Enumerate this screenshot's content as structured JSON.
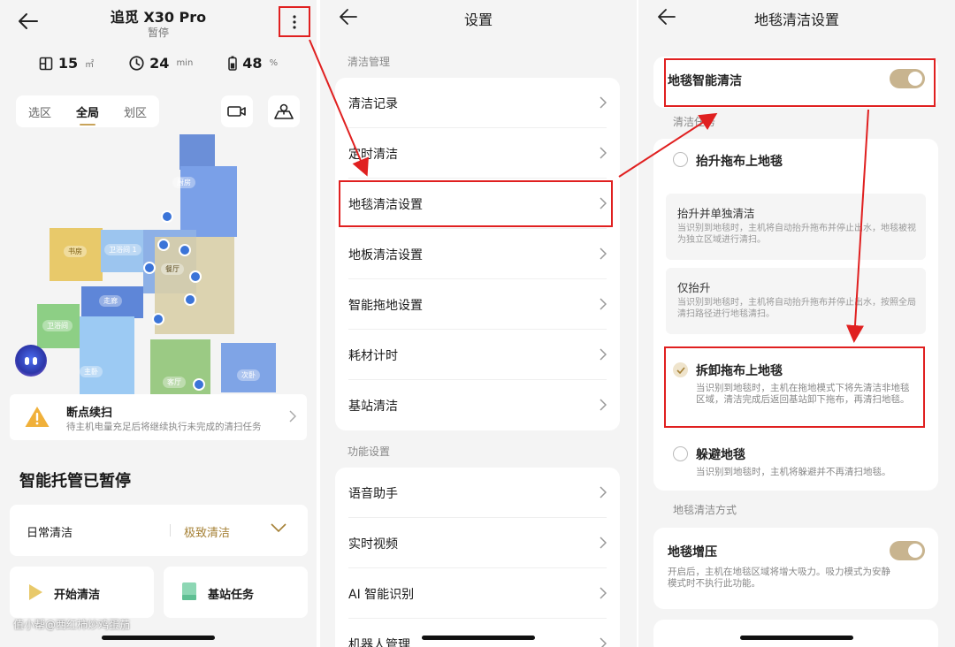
{
  "panel1": {
    "device_name": "追觅 X30 Pro",
    "status": "暂停",
    "stats": [
      {
        "icon": "area-icon",
        "value": "15",
        "unit": "㎡"
      },
      {
        "icon": "clock-icon",
        "value": "24",
        "unit": "min"
      },
      {
        "icon": "battery-icon",
        "value": "48",
        "unit": "%"
      }
    ],
    "map_modes": [
      "选区",
      "全局",
      "划区"
    ],
    "active_mode": "全局",
    "rooms": {
      "kitchen": "厨房",
      "study": "书房",
      "bathroom1": "卫浴间 1",
      "dining": "餐厅",
      "hallway": "走廊",
      "bathroom": "卫浴间",
      "master": "主卧",
      "living": "客厅",
      "second": "次卧"
    },
    "resume": {
      "title": "断点续扫",
      "desc": "待主机电量充足后将继续执行未完成的清扫任务"
    },
    "sheet_title": "智能托管已暂停",
    "clean_mode": {
      "left": "日常清洁",
      "right": "极致清洁"
    },
    "actions": {
      "start": "开始清洁",
      "station": "基站任务"
    },
    "watermark": "值小帮@西红柿炒鸡蛋茄"
  },
  "panel2": {
    "title": "设置",
    "section1": "清洁管理",
    "group1": [
      "清洁记录",
      "定时清洁",
      "地毯清洁设置",
      "地板清洁设置",
      "智能拖地设置",
      "耗材计时",
      "基站清洁"
    ],
    "section2": "功能设置",
    "group2": [
      "语音助手",
      "实时视频",
      "AI 智能识别",
      "机器人管理"
    ]
  },
  "panel3": {
    "title": "地毯清洁设置",
    "smart_clean": "地毯智能清洁",
    "task_label": "清洁任务",
    "options": {
      "lift": "抬升拖布上地毯",
      "lift_separate": {
        "title": "抬升并单独清洁",
        "desc": "当识别到地毯时，主机将自动抬升拖布并停止出水，地毯被视为独立区域进行清扫。"
      },
      "lift_only": {
        "title": "仅抬升",
        "desc": "当识别到地毯时，主机将自动抬升拖布并停止出水，按照全局清扫路径进行地毯清扫。"
      },
      "remove": {
        "title": "拆卸拖布上地毯",
        "desc": "当识别到地毯时，主机在拖地模式下将先清洁非地毯区域，清洁完成后返回基站卸下拖布，再清扫地毯。"
      },
      "avoid": {
        "title": "躲避地毯",
        "desc": "当识别到地毯时，主机将躲避并不再清扫地毯。"
      }
    },
    "method_label": "地毯清洁方式",
    "boost": {
      "title": "地毯增压",
      "desc": "开启后，主机在地毯区域将增大吸力。吸力模式为安静模式时不执行此功能。"
    }
  },
  "colors": {
    "accent": "#c8b48f",
    "highlight": "#e02020",
    "gold_text": "#a58035"
  }
}
